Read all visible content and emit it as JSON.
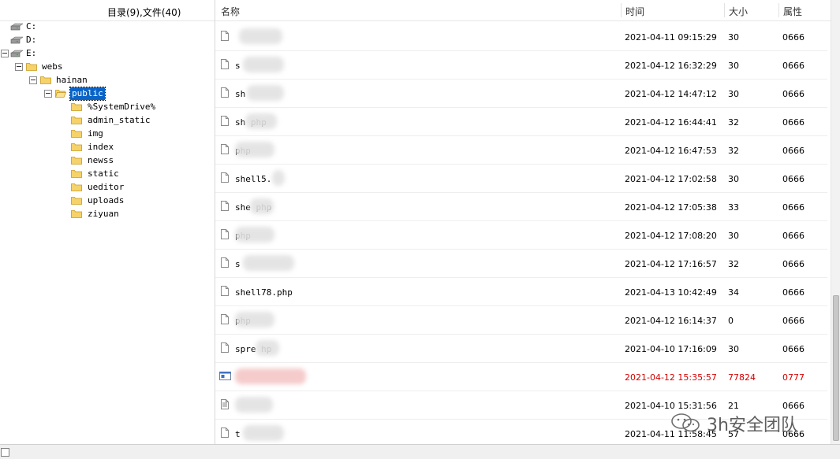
{
  "tree": {
    "summary": "目录(9),文件(40)",
    "nodes": [
      {
        "label": "C:"
      },
      {
        "label": "D:"
      },
      {
        "label": "E:"
      },
      {
        "label": "webs"
      },
      {
        "label": "hainan"
      },
      {
        "label": "public"
      },
      {
        "label": "%SystemDrive%"
      },
      {
        "label": "admin_static"
      },
      {
        "label": "img"
      },
      {
        "label": "index"
      },
      {
        "label": "newss"
      },
      {
        "label": "static"
      },
      {
        "label": "ueditor"
      },
      {
        "label": "uploads"
      },
      {
        "label": "ziyuan"
      }
    ]
  },
  "list": {
    "columns": {
      "name": "名称",
      "time": "时间",
      "size": "大小",
      "attr": "属性"
    },
    "rows": [
      {
        "name": "",
        "time": "2021-04-11 09:15:29",
        "size": "30",
        "attr": "0666"
      },
      {
        "name": "s",
        "time": "2021-04-12 16:32:29",
        "size": "30",
        "attr": "0666"
      },
      {
        "name": "sh",
        "time": "2021-04-12 14:47:12",
        "size": "30",
        "attr": "0666"
      },
      {
        "name": "sh       php",
        "time": "2021-04-12 16:44:41",
        "size": "32",
        "attr": "0666"
      },
      {
        "name": "         php",
        "time": "2021-04-12 16:47:53",
        "size": "32",
        "attr": "0666"
      },
      {
        "name": "shell5.",
        "time": "2021-04-12 17:02:58",
        "size": "30",
        "attr": "0666"
      },
      {
        "name": "she      php",
        "time": "2021-04-12 17:05:38",
        "size": "33",
        "attr": "0666"
      },
      {
        "name": "         php",
        "time": "2021-04-12 17:08:20",
        "size": "30",
        "attr": "0666"
      },
      {
        "name": "s",
        "time": "2021-04-12 17:16:57",
        "size": "32",
        "attr": "0666"
      },
      {
        "name": "shell78.php",
        "time": "2021-04-13 10:42:49",
        "size": "34",
        "attr": "0666"
      },
      {
        "name": "         php",
        "time": "2021-04-12 16:14:37",
        "size": "0",
        "attr": "0666"
      },
      {
        "name": "spre      hp",
        "time": "2021-04-10 17:16:09",
        "size": "30",
        "attr": "0666"
      },
      {
        "name": "",
        "time": "2021-04-12 15:35:57",
        "size": "77824",
        "attr": "0777"
      },
      {
        "name": "",
        "time": "2021-04-10 15:31:56",
        "size": "21",
        "attr": "0666"
      },
      {
        "name": "t",
        "time": "2021-04-11 11:58:45",
        "size": "57",
        "attr": "0666"
      }
    ]
  },
  "watermark": {
    "text": "3h安全团队"
  }
}
